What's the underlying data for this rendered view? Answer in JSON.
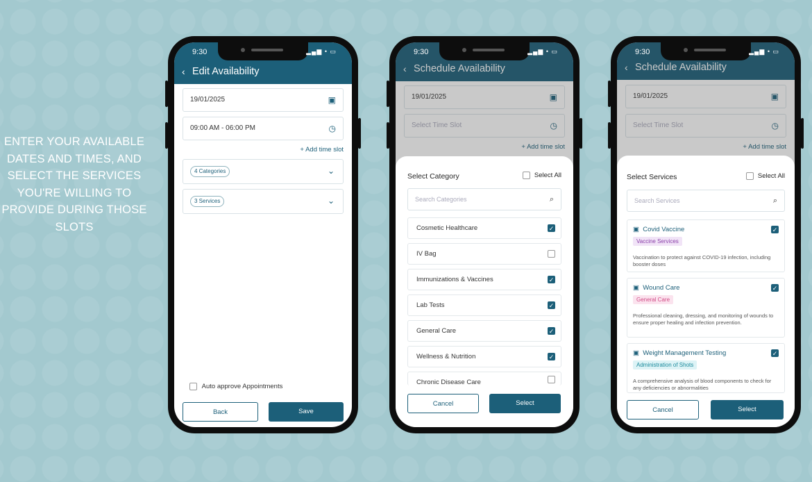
{
  "caption": "ENTER YOUR AVAILABLE DATES AND TIMES, AND SELECT THE SERVICES YOU'RE WILLING TO PROVIDE DURING THOSE SLOTS",
  "status_time": "9:30",
  "status_icons": "▂▄▆ • ▭",
  "colors": {
    "brand": "#1c5f79",
    "background": "#a3c9cf"
  },
  "phone1": {
    "title": "Edit Availability",
    "date": "19/01/2025",
    "time_slot": "09:00 AM - 06:00 PM",
    "add_time_slot": "+ Add time slot",
    "categories_chip": "4 Categories",
    "services_chip": "3 Services",
    "auto_approve": "Auto approve Appointments",
    "back": "Back",
    "save": "Save"
  },
  "phone2": {
    "title": "Schedule Availability",
    "date": "19/01/2025",
    "time_placeholder": "Select Time Slot",
    "add_time_slot": "+ Add time slot",
    "sheet_title": "Select Category",
    "select_all": "Select All",
    "search_placeholder": "Search Categories",
    "categories": [
      {
        "label": "Cosmetic Healthcare",
        "checked": true
      },
      {
        "label": "IV Bag",
        "checked": false
      },
      {
        "label": "Immunizations & Vaccines",
        "checked": true
      },
      {
        "label": "Lab Tests",
        "checked": true
      },
      {
        "label": "General Care",
        "checked": true
      },
      {
        "label": "Wellness & Nutrition",
        "checked": true
      },
      {
        "label": "Chronic Disease Care",
        "checked": false
      }
    ],
    "cancel": "Cancel",
    "select": "Select"
  },
  "phone3": {
    "title": "Schedule Availability",
    "date": "19/01/2025",
    "time_placeholder": "Select Time Slot",
    "add_time_slot": "+ Add time slot",
    "sheet_title": "Select Services",
    "select_all": "Select All",
    "search_placeholder": "Search Services",
    "services": [
      {
        "name": "Covid Vaccine",
        "tag": "Vaccine Services",
        "desc": "Vaccination to protect against COVID-19 infection, including booster doses"
      },
      {
        "name": "Wound Care",
        "tag": "General Care",
        "desc": "Professional cleaning, dressing, and monitoring of wounds to ensure proper healing and infection prevention."
      },
      {
        "name": "Weight Management Testing",
        "tag": "Administration of Shots",
        "desc": "A comprehensive analysis of blood components to check for any deficiencies or abnormalities"
      }
    ],
    "cancel": "Cancel",
    "select": "Select"
  }
}
